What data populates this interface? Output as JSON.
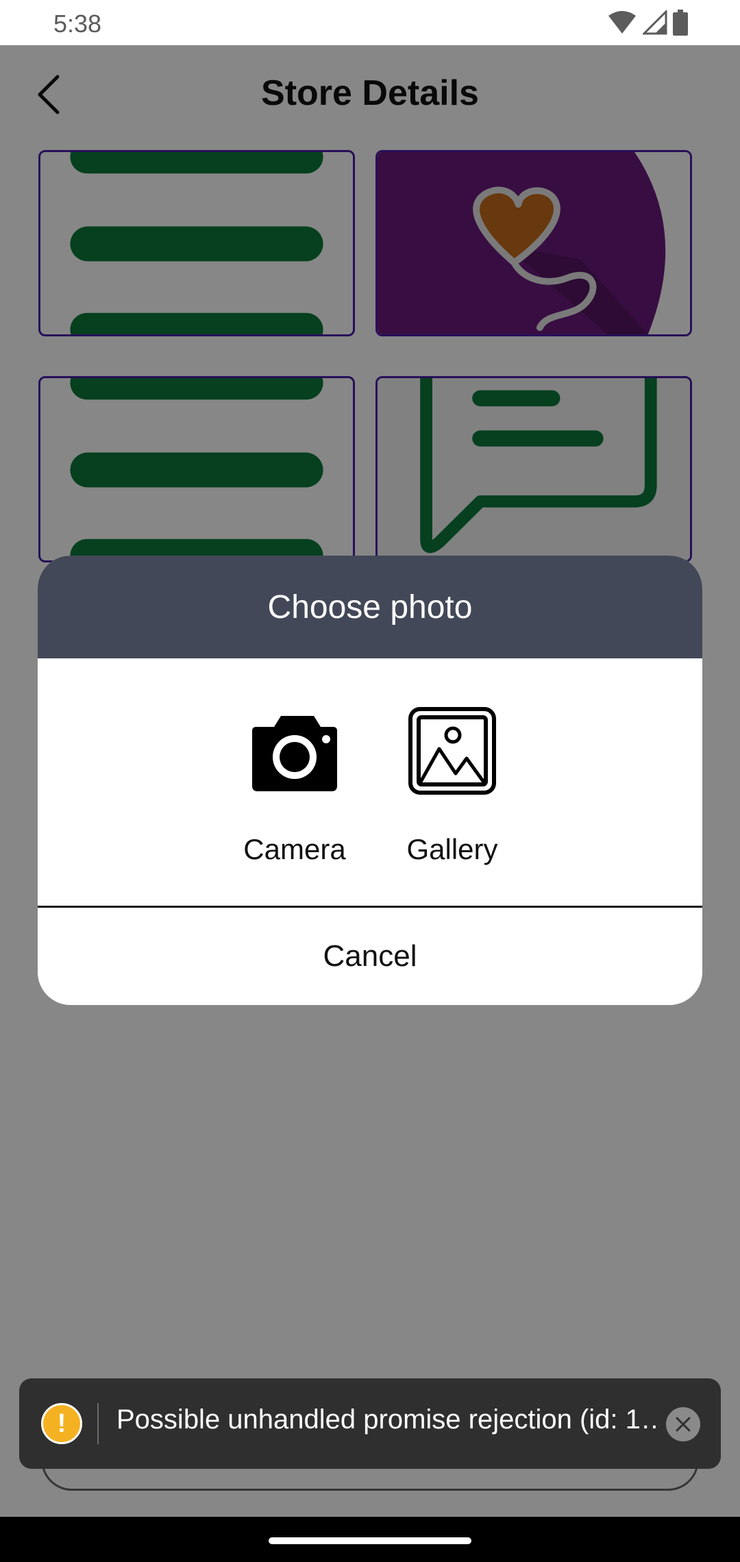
{
  "status_bar": {
    "time": "5:38",
    "icons": [
      "wifi-icon",
      "cell-signal-icon",
      "battery-icon"
    ]
  },
  "header": {
    "back_icon": "chevron-left-icon",
    "title": "Store Details"
  },
  "image_tiles": [
    {
      "content": "green-menu-lines-image"
    },
    {
      "content": "purple-heart-cable-image"
    },
    {
      "content": "green-menu-lines-image"
    },
    {
      "content": "green-chat-bubble-image"
    }
  ],
  "dialog": {
    "title": "Choose photo",
    "options": [
      {
        "label": "Camera",
        "icon": "camera-icon"
      },
      {
        "label": "Gallery",
        "icon": "gallery-icon"
      }
    ],
    "cancel_label": "Cancel"
  },
  "toast": {
    "icon": "warning-icon",
    "glyph": "!",
    "message": "Possible unhandled promise rejection (id: 1…",
    "close_icon": "close-icon"
  },
  "colors": {
    "tile_border": "#4a1fa8",
    "menu_green": "#0c7a3b",
    "tile_purple": "#6b1c7d",
    "dialog_header": "#434858",
    "toast_background": "#2f2f2f",
    "warning": "#f4b223"
  }
}
